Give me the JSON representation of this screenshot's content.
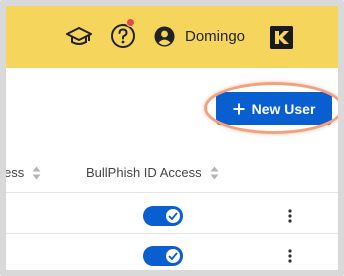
{
  "header": {
    "user_name": "Domingo",
    "icons": [
      "graduation-cap-icon",
      "help-icon",
      "user-avatar-icon",
      "brand-logo-icon"
    ],
    "background_color": "#f6d55c",
    "notification_dot_color": "#e64a4a"
  },
  "actions": {
    "new_user_label": "New User",
    "new_user_icon": "plus-icon",
    "button_color": "#0a5fd0",
    "highlight_color": "#f0a27c"
  },
  "table": {
    "columns": [
      {
        "label": "ess",
        "sortable": true
      },
      {
        "label": "BullPhish ID Access",
        "sortable": true
      }
    ],
    "rows": [
      {
        "bullphish_access": true
      },
      {
        "bullphish_access": true
      }
    ],
    "toggle_on_color": "#0a5fd0"
  }
}
